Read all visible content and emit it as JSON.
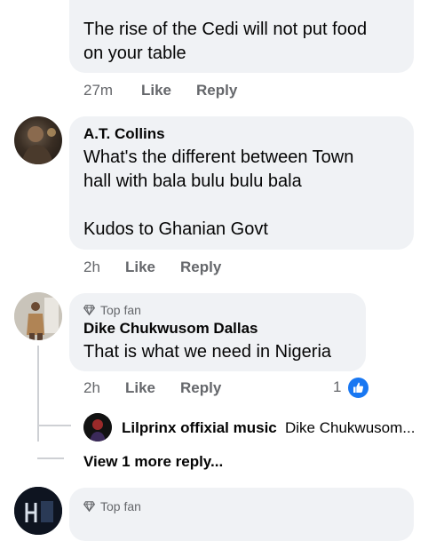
{
  "comment1": {
    "text": "The rise of the Cedi will not put food\non your table",
    "time": "27m",
    "like_label": "Like",
    "reply_label": "Reply"
  },
  "comment2": {
    "author": "A.T. Collins",
    "text": "What's the different between Town\nhall with bala bulu bulu bala\n\nKudos to Ghanian Govt",
    "time": "2h",
    "like_label": "Like",
    "reply_label": "Reply"
  },
  "comment3": {
    "badge": "Top fan",
    "author": "Dike Chukwusom Dallas",
    "text": "That is what we need in Nigeria",
    "time": "2h",
    "like_label": "Like",
    "reply_label": "Reply",
    "reaction_count": "1",
    "reaction_icon": "like-thumb-icon",
    "reply_preview": {
      "author": "Lilprinx offixial music",
      "text": "Dike Chukwusom..."
    },
    "view_more": "View 1 more reply..."
  },
  "comment4": {
    "badge": "Top fan"
  },
  "colors": {
    "bubble": "#f0f2f5",
    "meta_text": "#65676b",
    "like_blue": "#1877f2"
  }
}
